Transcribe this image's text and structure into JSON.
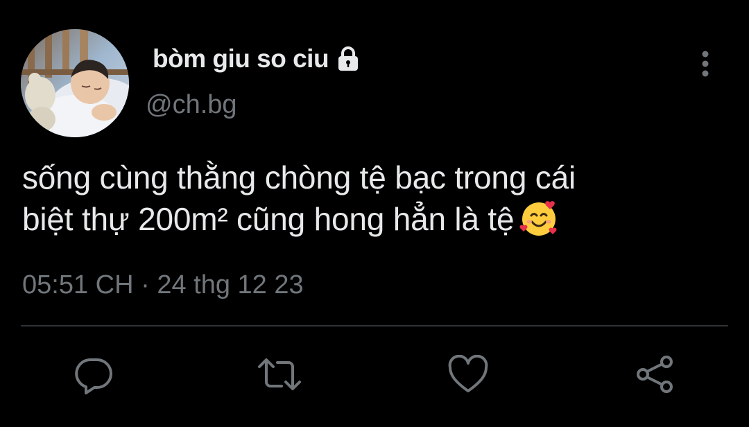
{
  "author": {
    "display_name": "bòm giu so ciu",
    "handle": "@ch.bg",
    "protected_icon": "lock-icon",
    "avatar": "profile-photo"
  },
  "tweet": {
    "text_line1": "sống cùng thằng chòng tệ bạc trong cái",
    "text_line2": "biệt thự 200m² cũng hong hẳn là tệ",
    "emoji": "smiling-face-with-hearts",
    "time": "05:51 CH",
    "separator": "·",
    "date": "24 thg 12 23"
  },
  "actions": {
    "reply_icon": "reply-icon",
    "retweet_icon": "retweet-icon",
    "like_icon": "heart-icon",
    "share_icon": "share-icon",
    "more_icon": "more-vertical-icon"
  },
  "colors": {
    "background": "#000000",
    "text_primary": "#E7E9EA",
    "text_secondary": "#71767B",
    "divider": "#2F3336"
  }
}
